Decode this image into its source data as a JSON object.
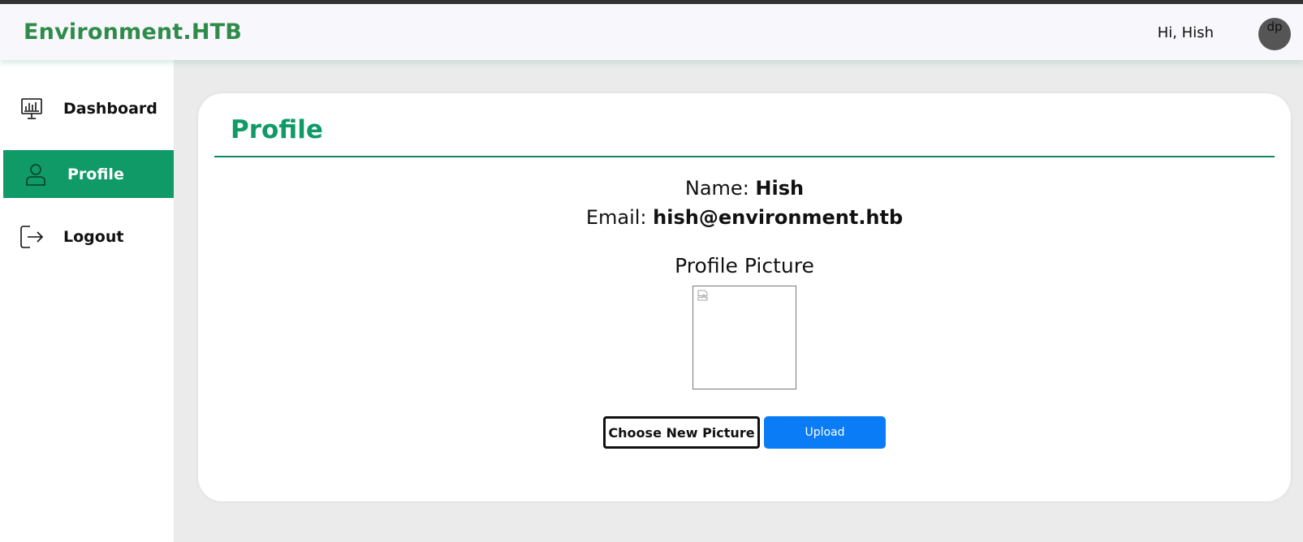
{
  "header": {
    "brand": "Environment.HTB",
    "greeting": "Hi, Hish",
    "avatar_text": "dp"
  },
  "sidebar": {
    "items": [
      {
        "label": "Dashboard",
        "icon": "dashboard-monitor-icon",
        "active": false
      },
      {
        "label": "Profile",
        "icon": "user-icon",
        "active": true
      },
      {
        "label": "Logout",
        "icon": "logout-icon",
        "active": false
      }
    ]
  },
  "profile": {
    "title": "Profile",
    "name_label": "Name:",
    "name_value": "Hish",
    "email_label": "Email:",
    "email_value": "hish@environment.htb",
    "picture_label": "Profile Picture",
    "choose_button": "Choose New Picture",
    "upload_button": "Upload"
  },
  "colors": {
    "accent": "#0f9a68",
    "brand": "#2e8b4a",
    "upload": "#0a7cf5"
  }
}
